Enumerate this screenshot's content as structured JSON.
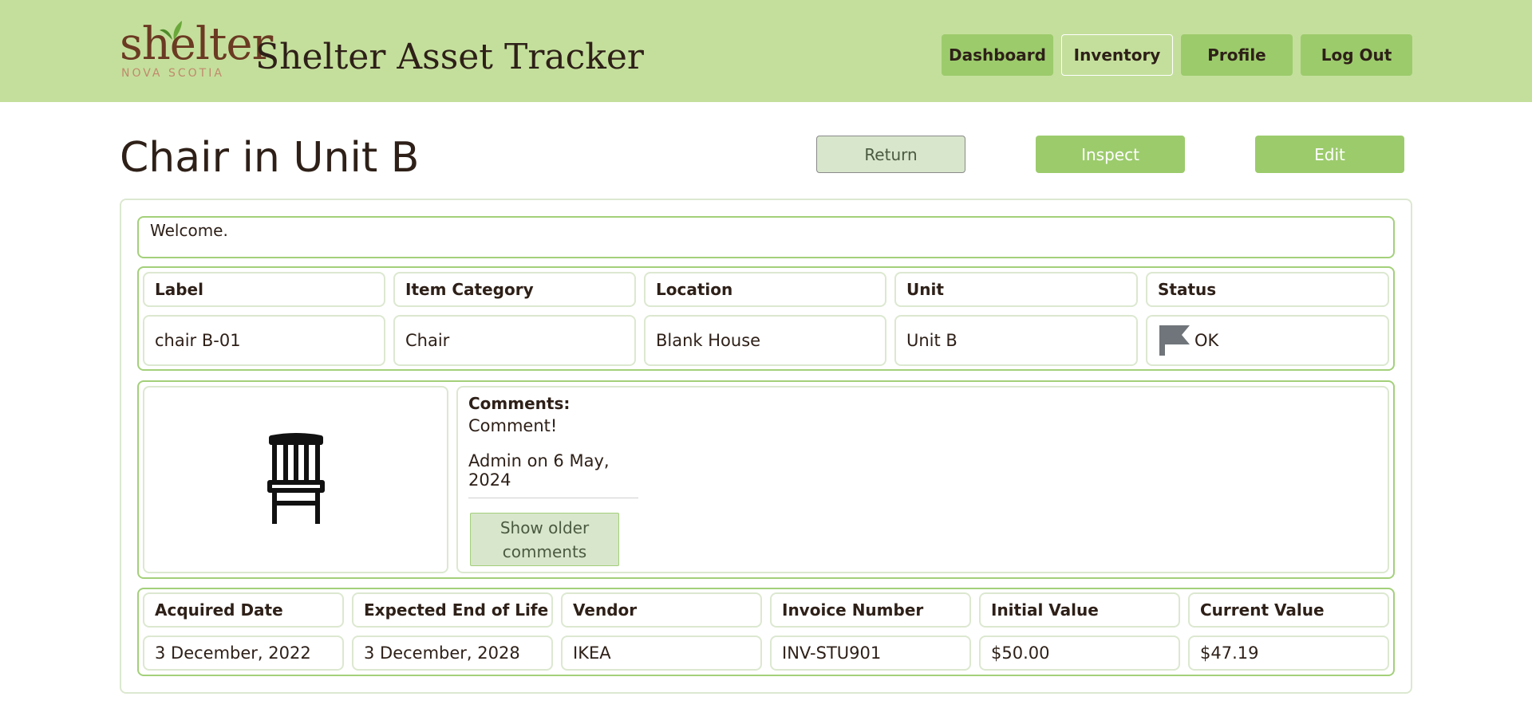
{
  "header": {
    "logo_word": "shelter",
    "logo_sub": "NOVA SCOTIA",
    "app_title": "Shelter Asset Tracker",
    "nav": [
      "Dashboard",
      "Inventory",
      "Profile",
      "Log Out"
    ],
    "active_nav": "Inventory"
  },
  "page": {
    "title": "Chair in Unit B",
    "actions": {
      "return": "Return",
      "inspect": "Inspect",
      "edit": "Edit"
    }
  },
  "welcome": "Welcome.",
  "summary": {
    "headers": [
      "Label",
      "Item Category",
      "Location",
      "Unit",
      "Status"
    ],
    "values": [
      "chair B-01",
      "Chair",
      "Blank House",
      "Unit B",
      "OK"
    ],
    "status_icon": "flag-icon",
    "status_color": "#6f757a"
  },
  "item_image": {
    "icon": "chair-icon"
  },
  "comments": {
    "title": "Comments:",
    "text": "Comment!",
    "meta": "Admin on 6 May, 2024",
    "older_button": "Show older comments"
  },
  "details": {
    "headers": [
      "Acquired Date",
      "Expected End of Life",
      "Vendor",
      "Invoice Number",
      "Initial Value",
      "Current Value"
    ],
    "values": [
      "3 December, 2022",
      "3 December, 2028",
      "IKEA",
      "INV-STU901",
      "$50.00",
      "$47.19"
    ]
  },
  "colors": {
    "header_bg": "#c4df9c",
    "button_green": "#9ccb6c",
    "border_green": "#a3d07a",
    "text_dark": "#2e2018"
  }
}
